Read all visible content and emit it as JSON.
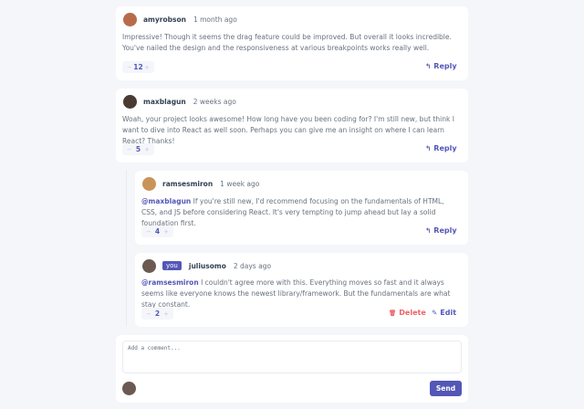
{
  "comments": [
    {
      "username": "amyrobson",
      "time": "1 month ago",
      "text": "Impressive! Though it seems the drag feature could be improved. But overall it looks incredible. You've nailed the design and the responsiveness at various breakpoints works really well.",
      "score": "12",
      "reply_label": "Reply",
      "avatar_color": "#b86b4a"
    },
    {
      "username": "maxblagun",
      "time": "2 weeks ago",
      "text": "Woah, your project looks awesome! How long have you been coding for? I'm still new, but think I want to dive into React as well soon. Perhaps you can give me an insight on where I can learn React? Thanks!",
      "score": "5",
      "reply_label": "Reply",
      "avatar_color": "#4a3a32"
    }
  ],
  "replies": [
    {
      "username": "ramsesmiron",
      "time": "1 week ago",
      "mention": "@maxblagun",
      "text": "If you're still new, I'd recommend focusing on the fundamentals of HTML, CSS, and JS before considering React. It's very tempting to jump ahead but lay a solid foundation first.",
      "score": "4",
      "reply_label": "Reply",
      "avatar_color": "#c9945a"
    },
    {
      "username": "juliusomo",
      "badge": "you",
      "time": "2 days ago",
      "mention": "@ramsesmiron",
      "text": "I couldn't agree more with this. Everything moves so fast and it always seems like everyone knows the newest library/framework. But the fundamentals are what stay constant.",
      "score": "2",
      "delete_label": "Delete",
      "edit_label": "Edit",
      "avatar_color": "#6b5a52"
    }
  ],
  "composer": {
    "placeholder": "Add a comment...",
    "send_label": "Send",
    "avatar_color": "#6b5a52"
  },
  "vote": {
    "minus": "−",
    "plus": "+"
  },
  "icons": {
    "reply": "↰",
    "delete": "🗑",
    "edit": "✎"
  },
  "colors": {
    "accent": "#5357b6",
    "danger": "#ed6368",
    "muted": "#c5c6ef"
  }
}
